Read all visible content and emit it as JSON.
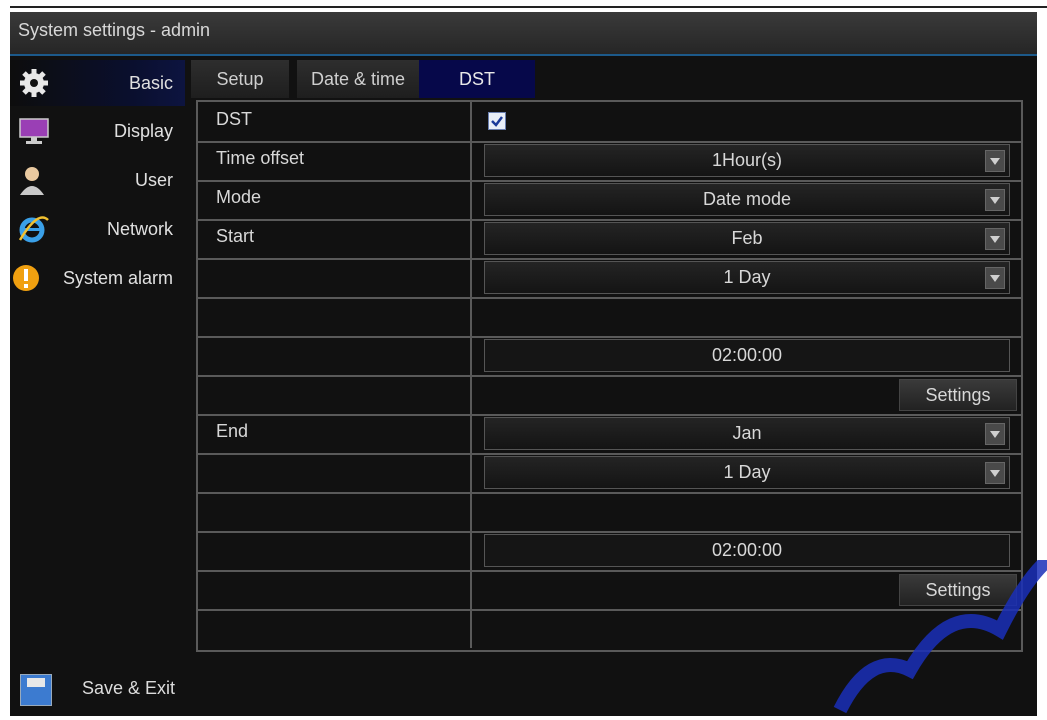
{
  "window": {
    "title": "System settings - admin"
  },
  "sidebar": {
    "items": [
      {
        "label": "Basic",
        "icon": "gear-icon",
        "active": true
      },
      {
        "label": "Display",
        "icon": "monitor-icon",
        "active": false
      },
      {
        "label": "User",
        "icon": "user-icon",
        "active": false
      },
      {
        "label": "Network",
        "icon": "internet-explorer-icon",
        "active": false
      },
      {
        "label": "System alarm",
        "icon": "alarm-icon",
        "active": false
      }
    ],
    "save_exit": "Save & Exit"
  },
  "tabs": [
    {
      "label": "Setup",
      "active": false
    },
    {
      "label": "Date & time",
      "active": false
    },
    {
      "label": "DST",
      "active": true
    }
  ],
  "form": {
    "dst_label": "DST",
    "dst_checked": true,
    "time_offset_label": "Time offset",
    "time_offset_value": "1Hour(s)",
    "mode_label": "Mode",
    "mode_value": "Date mode",
    "start_label": "Start",
    "start_month": "Feb",
    "start_day": "1 Day",
    "start_time": "02:00:00",
    "start_settings": "Settings",
    "end_label": "End",
    "end_month": "Jan",
    "end_day": "1 Day",
    "end_time": "02:00:00",
    "end_settings": "Settings"
  },
  "colors": {
    "active_blue": "#06084a",
    "watermark": "#1a2fb8"
  }
}
